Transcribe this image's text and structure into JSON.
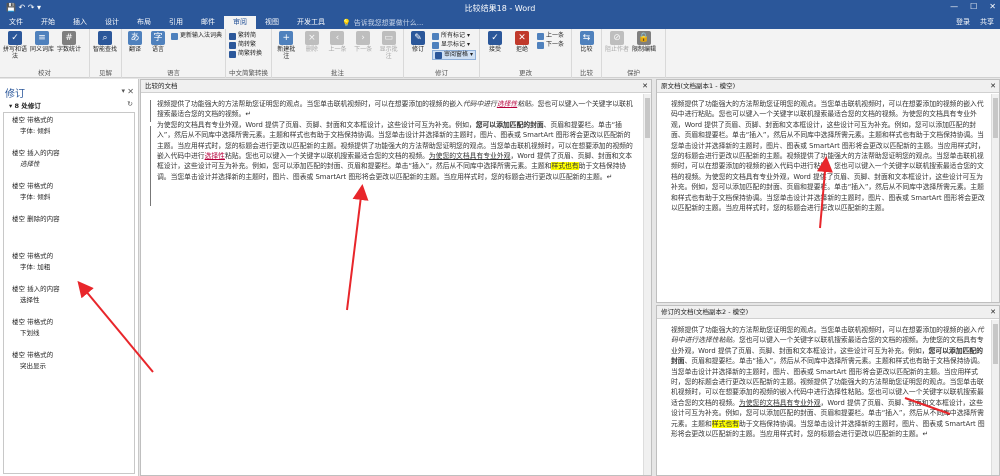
{
  "titlebar": {
    "title": "比较结果18 - Word",
    "min": "—",
    "max": "☐",
    "close": "✕",
    "qat": "💾 ↶ ↷ ▾"
  },
  "tabs": [
    {
      "label": "文件",
      "active": false
    },
    {
      "label": "开始",
      "active": false
    },
    {
      "label": "插入",
      "active": false
    },
    {
      "label": "设计",
      "active": false
    },
    {
      "label": "布局",
      "active": false
    },
    {
      "label": "引用",
      "active": false
    },
    {
      "label": "邮件",
      "active": false
    },
    {
      "label": "审阅",
      "active": true
    },
    {
      "label": "视图",
      "active": false
    },
    {
      "label": "开发工具",
      "active": false
    }
  ],
  "tellme": "告诉我您想要做什么...",
  "account": {
    "login": "登录",
    "share": "共享"
  },
  "ribbon": {
    "proofing": {
      "label": "校对",
      "spell": "拼写和语法",
      "thesaurus": "同义词库",
      "wordcount": "字数统计"
    },
    "insights": {
      "label": "见解",
      "smart": "智能查找"
    },
    "language": {
      "label": "语言",
      "translate": "翻译",
      "lang": "语言",
      "update_ime": "更新输入法词典"
    },
    "chinese": {
      "label": "中文简繁转换",
      "to_trad": "繁转简",
      "to_simp": "简转繁",
      "convert": "简繁转换"
    },
    "comments": {
      "label": "批注",
      "new": "新建批注",
      "delete": "删除",
      "prev": "上一条",
      "next": "下一条",
      "show": "显示批注"
    },
    "tracking": {
      "label": "修订",
      "track": "修订",
      "markup": "所有标记",
      "show_markup": "显示标记",
      "pane": "审阅窗格"
    },
    "changes": {
      "label": "更改",
      "accept": "接受",
      "reject": "拒绝",
      "prev": "上一条",
      "next": "下一条"
    },
    "compare": {
      "label": "比较",
      "compare": "比较"
    },
    "protect": {
      "label": "保护",
      "block": "阻止作者",
      "restrict": "限制编辑"
    }
  },
  "revisions_pane": {
    "title": "修订",
    "count": "8 处修订",
    "items": [
      {
        "line1": "楼空 带格式的",
        "line2": "字体: 倾斜"
      },
      {
        "line1": "楼空 插入的内容",
        "line2": "选择性"
      },
      {
        "line1": "楼空 带格式的",
        "line2": "字体: 倾斜"
      },
      {
        "line1": "楼空 删除的内容",
        "line2": ""
      },
      {
        "line1": "楼空 带格式的",
        "line2": "字体: 加粗"
      },
      {
        "line1": "楼空 插入的内容",
        "line2": "选择性"
      },
      {
        "line1": "楼空 带格式的",
        "line2": "下划线"
      },
      {
        "line1": "楼空 带格式的",
        "line2": "突出显示"
      }
    ]
  },
  "compared_doc": {
    "title": "比较的文档",
    "p1a": "视频提供了功能强大的方法帮助您证明您的观点。当您单击联机视频时，可以在想要添加的视频的嵌入",
    "p1b": "代码中进行",
    "p1c": "选择性",
    "p1d": "粘贴。",
    "p1e": "您也可以键入一个关键字以联机搜索最适合您的文档的视频。",
    "p2a": "为使您的文档具有专业外观，Word 提供了页眉、页脚、封面和文本框设计，这些设计可互为补充。例如，",
    "p2b": "您可以添加匹配的封面",
    "p2c": "、页眉和提要栏。单击“插入”，然后从不同库中选择所需元素。主题和样式也有助于文档保持协调。当您单击设计并选择新的主题时，图片、图表或 SmartArt 图形将会更改以匹配新的主题。当应用样式时，您的标题会进行更改以匹配新的主题。视频提供了功能强大的方法帮助您证明您的观点。当您单击联机视频时，可以在想要添加的视频的嵌入代码中进行",
    "p2d": "选择性",
    "p2e": "粘贴。您也可以键入一个关键字以联机搜索最适合您的文档的视频。",
    "p2f": "为使您的文档具有专业外观",
    "p2g": "，Word 提供了页眉、页脚、封面和文本框设计，这些设计可互为补充。例如，您可以添加匹配的封面、页眉和提要栏。单击“插入”，然后从不同库中选择所需元素。主题和",
    "p2h": "样式也有",
    "p2i": "助于文档保持协调。当您单击设计并选择新的主题时，图片、图表或 SmartArt 图形将会更改以匹配新的主题。当应用样式时，您的标题会进行更改以匹配新的主题。"
  },
  "original_doc": {
    "title": "原文档(文档副本1 - 模空)",
    "text": "视频提供了功能强大的方法帮助您证明您的观点。当您单击联机视频时，可以在想要添加的视频的嵌入代码中进行粘贴。您也可以键入一个关键字以联机搜索最适合您的文档的视频。为使您的文档具有专业外观，Word 提供了页眉、页脚、封面和文本框设计，这些设计可互为补充。例如，您可以添加匹配的封面、页眉和提要栏。单击“插入”，然后从不同库中选择所需元素。主题和样式也有助于文档保持协调。当您单击设计并选择新的主题时，图片、图表或 SmartArt 图形将会更改以匹配新的主题。当应用样式时，您的标题会进行更改以匹配新的主题。视频提供了功能强大的方法帮助您证明您的观点。当您单击联机视频时，可以在想要添加的视频的嵌入代码中进行粘贴。您也可以键入一个关键字以联机搜索最适合您的文档的视频。为使您的文档具有专业外观，Word 提供了页眉、页脚、封面和文本框设计，这些设计可互为补充。例如，您可以添加匹配的封面、页眉和提要栏。单击“插入”，然后从不同库中选择所需元素。主题和样式也有助于文档保持协调。当您单击设计并选择新的主题时，图片、图表或 SmartArt 图形将会更改以匹配新的主题。当应用样式时，您的标题会进行更改以匹配新的主题。"
  },
  "revised_doc": {
    "title": "修订的文档(文档副本2 - 模空)",
    "t1": "视频提供了功能强大的方法帮助您证明您的观点。当您单击联机视频时，可以在想要添加的视频的嵌入",
    "t2": "代码中进行选择性粘贴。",
    "t3": "您也可以键入一个关键字以联机搜索最适合您的文档的视频。为使您的文档具有专业外观，Word 提供了页眉、页脚、封面和文本框设计，这些设计可互为补充。例如，",
    "t4": "您可以添加匹配的封面",
    "t5": "、页眉和提要栏。单击“插入”，然后从不同库中选择所需元素。主题和样式也有助于文档保持协调。当您单击设计并选择新的主题时，图片、图表或 SmartArt 图形将会更改以匹配新的主题。当应用样式时，您的标题会进行更改以匹配新的主题。视频提供了功能强大的方法帮助您证明您的观点。当您单击联机视频时，可以在想要添加的视频的嵌入代码中进行选择性粘贴。您也可以键入一个关键字以联机搜索最适合您的文档的视频。",
    "t6": "为使您的文档具有专业外观",
    "t7": "，Word 提供了页眉、页脚、封面和文本框设计，这些设计可互为补充。例如，您可以添加匹配的封面、页眉和提要栏。单击“插入”，然后从不同库中选择所需元素。主题和",
    "t8": "样式也有",
    "t9": "助于文档保持协调。当您单击设计并选择新的主题时，图片、图表或 SmartArt 图形将会更改以匹配新的主题。当应用样式时，您的标题会进行更改以匹配新的主题。"
  },
  "colors": {
    "accent": "#2b579a",
    "arrow": "#e8262b",
    "highlight": "#ffff00",
    "insert": "#b5003a"
  }
}
